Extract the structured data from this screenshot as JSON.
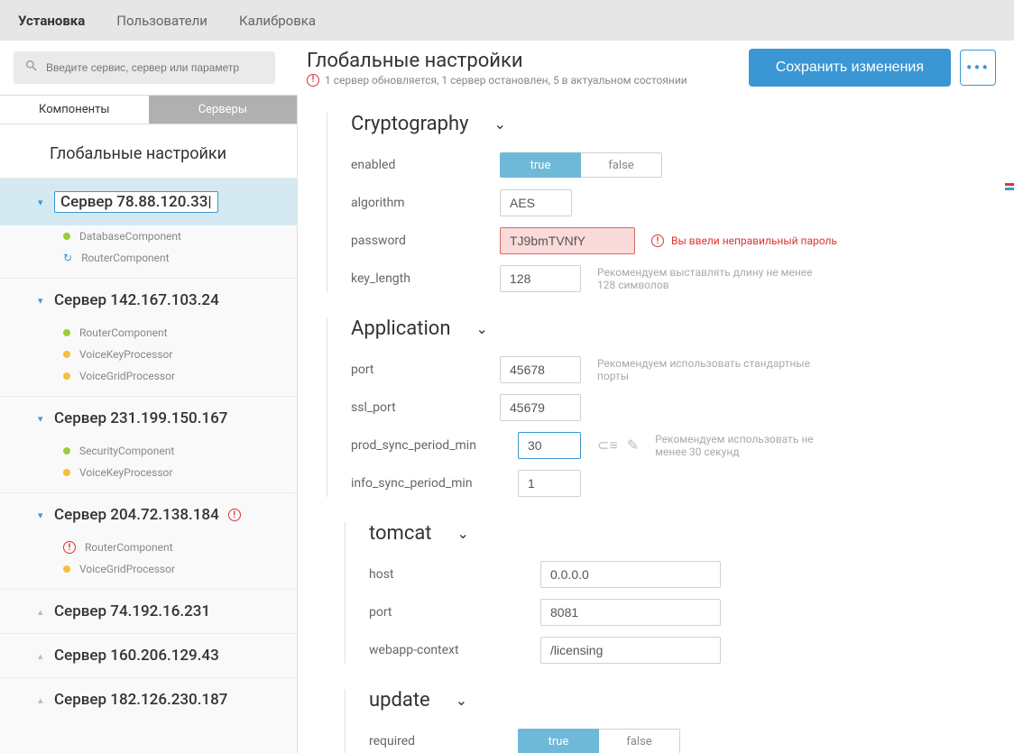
{
  "topnav": {
    "tabs": [
      "Установка",
      "Пользователи",
      "Калибровка"
    ],
    "active": 0
  },
  "search": {
    "placeholder": "Введите сервис, сервер или параметр"
  },
  "header": {
    "title": "Глобальные настройки",
    "status": "1 сервер обновляется, 1 сервер остановлен, 5 в актуальном состоянии",
    "save_label": "Сохранить изменения"
  },
  "subtabs": {
    "components": "Компоненты",
    "servers": "Серверы"
  },
  "sidebar": {
    "global_label": "Глобальные настройки",
    "servers": [
      {
        "name": "Сервер 78.88.120.33",
        "selected": true,
        "expanded": true,
        "alert": false,
        "children": [
          {
            "name": "DatabaseComponent",
            "state": "green"
          },
          {
            "name": "RouterComponent",
            "state": "sync"
          }
        ]
      },
      {
        "name": "Сервер 142.167.103.24",
        "expanded": true,
        "alert": false,
        "children": [
          {
            "name": "RouterComponent",
            "state": "green"
          },
          {
            "name": "VoiceKeyProcessor",
            "state": "yellow"
          },
          {
            "name": "VoiceGridProcessor",
            "state": "yellow"
          }
        ]
      },
      {
        "name": "Сервер 231.199.150.167",
        "expanded": true,
        "alert": false,
        "children": [
          {
            "name": "SecurityComponent",
            "state": "green"
          },
          {
            "name": "VoiceKeyProcessor",
            "state": "yellow"
          }
        ]
      },
      {
        "name": "Сервер 204.72.138.184",
        "expanded": true,
        "alert": true,
        "children": [
          {
            "name": "RouterComponent",
            "state": "error"
          },
          {
            "name": "VoiceGridProcessor",
            "state": "yellow"
          }
        ]
      },
      {
        "name": "Сервер 74.192.16.231",
        "expanded": false
      },
      {
        "name": "Сервер 160.206.129.43",
        "expanded": false
      },
      {
        "name": "Сервер 182.126.230.187",
        "expanded": false
      }
    ]
  },
  "sections": {
    "cryptography": {
      "title": "Cryptography",
      "enabled_label": "enabled",
      "true": "true",
      "false": "false",
      "algorithm_label": "algorithm",
      "algorithm_value": "AES",
      "password_label": "password",
      "password_value": "TJ9bmTVNfY",
      "password_error": "Вы ввели неправильный пароль",
      "key_length_label": "key_length",
      "key_length_value": "128",
      "key_length_hint": "Рекомендуем выставлять длину не менее 128 символов"
    },
    "application": {
      "title": "Application",
      "port_label": "port",
      "port_value": "45678",
      "port_hint": "Рекомендуем использовать стандартные порты",
      "ssl_port_label": "ssl_port",
      "ssl_port_value": "45679",
      "prod_sync_label": "prod_sync_period_min",
      "prod_sync_value": "30",
      "prod_sync_hint": "Рекомендуем использовать не менее 30 секунд",
      "info_sync_label": "info_sync_period_min",
      "info_sync_value": "1"
    },
    "tomcat": {
      "title": "tomcat",
      "host_label": "host",
      "host_value": "0.0.0.0",
      "port_label": "port",
      "port_value": "8081",
      "ctx_label": "webapp-context",
      "ctx_value": "/licensing"
    },
    "update": {
      "title": "update",
      "required_label": "required",
      "true": "true",
      "false": "false"
    }
  }
}
